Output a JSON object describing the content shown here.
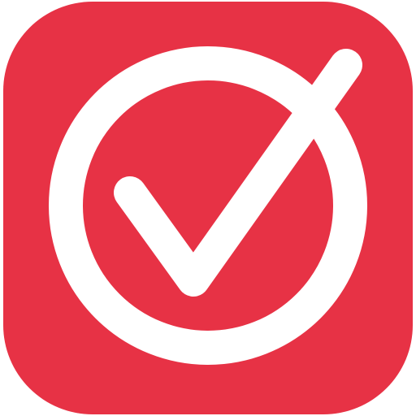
{
  "icon": {
    "name": "circle-check-icon",
    "background_color": "#E73245",
    "glyph_color": "#FFFFFF"
  }
}
